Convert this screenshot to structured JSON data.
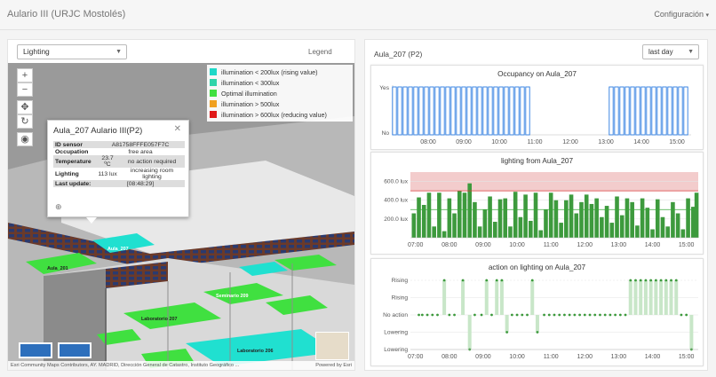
{
  "header": {
    "title": "Aulario III (URJC Mostolés)",
    "config_label": "Configuración",
    "config_caret": "▾"
  },
  "map_panel": {
    "layer_select": "Lighting",
    "legend_title": "Legend",
    "legend": [
      {
        "label": "illumination < 200lux (rising value)",
        "color": "#1ed8c8"
      },
      {
        "label": "illumination < 300lux",
        "color": "#2fd4aa"
      },
      {
        "label": "Optimal illumination",
        "color": "#40e040"
      },
      {
        "label": "illumination > 500lux",
        "color": "#f0a020"
      },
      {
        "label": "illumination > 600lux (reducing value)",
        "color": "#e01818"
      }
    ],
    "zoom_in": "+",
    "zoom_out": "−",
    "pan_icon": "✥",
    "rotate_icon": "↻",
    "eye_icon": "◉",
    "popup": {
      "title": "Aula_207 Aulario III(P2)",
      "close": "✕",
      "rows": [
        {
          "key": "ID sensor",
          "v1": "A81758FFFE057F7C",
          "v2": ""
        },
        {
          "key": "Occupation",
          "v1": "free area",
          "v2": ""
        },
        {
          "key": "Temperature",
          "v1": "23.7 ºC",
          "v2": "no action required"
        },
        {
          "key": "Lighting",
          "v1": "113 lux",
          "v2": "increasing room lighting"
        },
        {
          "key": "Last update:",
          "v1": "[08:48:29]",
          "v2": ""
        }
      ],
      "zoom_icon": "⊕"
    },
    "room_labels": [
      "Aula_201",
      "Aula_207",
      "Seminario 209",
      "Laboratorio 207",
      "Laboratorio 206"
    ],
    "attribution": "Esri Community Maps Contributors, AY. MADRID, Dirección General de Catastro, Instituto Geográfico ...",
    "powered": "Powered by Esri"
  },
  "chart_panel": {
    "room_title": "Aula_207 (P2)",
    "range_select": "last day"
  },
  "chart_data": [
    {
      "type": "bar",
      "title": "Occupancy on Aula_207",
      "y_categories": [
        "No",
        "Yes"
      ],
      "x_ticks": [
        "08:00",
        "09:00",
        "10:00",
        "11:00",
        "12:00",
        "13:00",
        "14:00",
        "15:00"
      ],
      "x_range": [
        7.0,
        15.4
      ],
      "values": [
        {
          "t": 7.05,
          "v": 1
        },
        {
          "t": 7.2,
          "v": 1
        },
        {
          "t": 7.35,
          "v": 1
        },
        {
          "t": 7.5,
          "v": 1
        },
        {
          "t": 7.65,
          "v": 1
        },
        {
          "t": 7.8,
          "v": 1
        },
        {
          "t": 7.95,
          "v": 1
        },
        {
          "t": 8.1,
          "v": 1
        },
        {
          "t": 8.25,
          "v": 1
        },
        {
          "t": 8.4,
          "v": 1
        },
        {
          "t": 8.55,
          "v": 1
        },
        {
          "t": 8.7,
          "v": 1
        },
        {
          "t": 8.85,
          "v": 1
        },
        {
          "t": 9.0,
          "v": 1
        },
        {
          "t": 9.15,
          "v": 1
        },
        {
          "t": 9.3,
          "v": 1
        },
        {
          "t": 9.45,
          "v": 1
        },
        {
          "t": 9.6,
          "v": 1
        },
        {
          "t": 9.75,
          "v": 1
        },
        {
          "t": 9.9,
          "v": 1
        },
        {
          "t": 10.05,
          "v": 1
        },
        {
          "t": 10.2,
          "v": 1
        },
        {
          "t": 10.35,
          "v": 1
        },
        {
          "t": 10.5,
          "v": 1
        },
        {
          "t": 10.65,
          "v": 1
        },
        {
          "t": 10.8,
          "v": 1
        },
        {
          "t": 13.15,
          "v": 1
        },
        {
          "t": 13.3,
          "v": 1
        },
        {
          "t": 13.45,
          "v": 1
        },
        {
          "t": 13.6,
          "v": 1
        },
        {
          "t": 13.75,
          "v": 1
        },
        {
          "t": 13.9,
          "v": 1
        },
        {
          "t": 14.05,
          "v": 1
        },
        {
          "t": 14.2,
          "v": 1
        },
        {
          "t": 14.35,
          "v": 1
        },
        {
          "t": 14.5,
          "v": 1
        },
        {
          "t": 14.65,
          "v": 1
        },
        {
          "t": 14.8,
          "v": 1
        },
        {
          "t": 14.95,
          "v": 1
        },
        {
          "t": 15.1,
          "v": 1
        },
        {
          "t": 15.25,
          "v": 1
        }
      ],
      "color": "#2b7be0"
    },
    {
      "type": "bar",
      "title": "lighting from Aula_207",
      "ylabel_unit": "lux",
      "y_ticks": [
        "200.0 lux",
        "400.0 lux",
        "600.0 lux"
      ],
      "y_range": [
        0,
        700
      ],
      "x_ticks": [
        "07:00",
        "08:00",
        "09:00",
        "10:00",
        "11:00",
        "12:00",
        "13:00",
        "14:00",
        "15:00"
      ],
      "x_range": [
        6.85,
        15.35
      ],
      "threshold_high": 500,
      "threshold_low": 300,
      "band_high": [
        500,
        700
      ],
      "color": "#3d9a3d",
      "values": [
        {
          "t": 6.95,
          "v": 260
        },
        {
          "t": 7.1,
          "v": 430
        },
        {
          "t": 7.25,
          "v": 350
        },
        {
          "t": 7.4,
          "v": 480
        },
        {
          "t": 7.55,
          "v": 120
        },
        {
          "t": 7.7,
          "v": 480
        },
        {
          "t": 7.85,
          "v": 70
        },
        {
          "t": 8.0,
          "v": 420
        },
        {
          "t": 8.15,
          "v": 260
        },
        {
          "t": 8.3,
          "v": 500
        },
        {
          "t": 8.45,
          "v": 480
        },
        {
          "t": 8.6,
          "v": 580
        },
        {
          "t": 8.75,
          "v": 380
        },
        {
          "t": 8.9,
          "v": 120
        },
        {
          "t": 9.05,
          "v": 300
        },
        {
          "t": 9.2,
          "v": 440
        },
        {
          "t": 9.35,
          "v": 170
        },
        {
          "t": 9.5,
          "v": 410
        },
        {
          "t": 9.65,
          "v": 420
        },
        {
          "t": 9.8,
          "v": 120
        },
        {
          "t": 9.95,
          "v": 490
        },
        {
          "t": 10.1,
          "v": 220
        },
        {
          "t": 10.25,
          "v": 460
        },
        {
          "t": 10.4,
          "v": 180
        },
        {
          "t": 10.55,
          "v": 480
        },
        {
          "t": 10.7,
          "v": 80
        },
        {
          "t": 10.85,
          "v": 300
        },
        {
          "t": 11.0,
          "v": 480
        },
        {
          "t": 11.15,
          "v": 400
        },
        {
          "t": 11.3,
          "v": 160
        },
        {
          "t": 11.45,
          "v": 400
        },
        {
          "t": 11.6,
          "v": 460
        },
        {
          "t": 11.75,
          "v": 260
        },
        {
          "t": 11.9,
          "v": 380
        },
        {
          "t": 12.05,
          "v": 460
        },
        {
          "t": 12.2,
          "v": 360
        },
        {
          "t": 12.35,
          "v": 420
        },
        {
          "t": 12.5,
          "v": 220
        },
        {
          "t": 12.65,
          "v": 340
        },
        {
          "t": 12.8,
          "v": 160
        },
        {
          "t": 12.95,
          "v": 440
        },
        {
          "t": 13.1,
          "v": 240
        },
        {
          "t": 13.25,
          "v": 420
        },
        {
          "t": 13.4,
          "v": 380
        },
        {
          "t": 13.55,
          "v": 130
        },
        {
          "t": 13.7,
          "v": 420
        },
        {
          "t": 13.85,
          "v": 320
        },
        {
          "t": 14.0,
          "v": 90
        },
        {
          "t": 14.15,
          "v": 410
        },
        {
          "t": 14.3,
          "v": 220
        },
        {
          "t": 14.45,
          "v": 120
        },
        {
          "t": 14.6,
          "v": 380
        },
        {
          "t": 14.75,
          "v": 260
        },
        {
          "t": 14.9,
          "v": 90
        },
        {
          "t": 15.05,
          "v": 420
        },
        {
          "t": 15.2,
          "v": 330
        },
        {
          "t": 15.3,
          "v": 480
        }
      ]
    },
    {
      "type": "scatter",
      "title": "action on lighting on Aula_207",
      "y_categories": [
        "Lowering",
        "Lowering",
        "No action",
        "Rising",
        "Rising"
      ],
      "x_ticks": [
        "07:00",
        "08:00",
        "09:00",
        "10:00",
        "11:00",
        "12:00",
        "13:00",
        "14:00",
        "15:00"
      ],
      "x_range": [
        6.85,
        15.35
      ],
      "color": "#c8e6c8",
      "values": [
        {
          "t": 7.1,
          "v": 0
        },
        {
          "t": 7.2,
          "v": 0
        },
        {
          "t": 7.35,
          "v": 0
        },
        {
          "t": 7.5,
          "v": 0
        },
        {
          "t": 7.65,
          "v": 0
        },
        {
          "t": 7.85,
          "v": 2
        },
        {
          "t": 8.0,
          "v": 0
        },
        {
          "t": 8.15,
          "v": 0
        },
        {
          "t": 8.4,
          "v": 2
        },
        {
          "t": 8.6,
          "v": -2
        },
        {
          "t": 8.75,
          "v": 0
        },
        {
          "t": 8.95,
          "v": 0
        },
        {
          "t": 9.1,
          "v": 2
        },
        {
          "t": 9.25,
          "v": 0
        },
        {
          "t": 9.4,
          "v": 2
        },
        {
          "t": 9.55,
          "v": 2
        },
        {
          "t": 9.7,
          "v": -1
        },
        {
          "t": 9.85,
          "v": 0
        },
        {
          "t": 10.0,
          "v": 0
        },
        {
          "t": 10.15,
          "v": 0
        },
        {
          "t": 10.3,
          "v": 0
        },
        {
          "t": 10.45,
          "v": 2
        },
        {
          "t": 10.6,
          "v": -1
        },
        {
          "t": 10.8,
          "v": 0
        },
        {
          "t": 10.95,
          "v": 0
        },
        {
          "t": 11.1,
          "v": 0
        },
        {
          "t": 11.25,
          "v": 0
        },
        {
          "t": 11.4,
          "v": 0
        },
        {
          "t": 11.55,
          "v": 0
        },
        {
          "t": 11.7,
          "v": 0
        },
        {
          "t": 11.85,
          "v": 0
        },
        {
          "t": 12.0,
          "v": 0
        },
        {
          "t": 12.15,
          "v": 0
        },
        {
          "t": 12.3,
          "v": 0
        },
        {
          "t": 12.45,
          "v": 0
        },
        {
          "t": 12.6,
          "v": 0
        },
        {
          "t": 12.75,
          "v": 0
        },
        {
          "t": 12.9,
          "v": 0
        },
        {
          "t": 13.05,
          "v": 0
        },
        {
          "t": 13.2,
          "v": 0
        },
        {
          "t": 13.35,
          "v": 2
        },
        {
          "t": 13.5,
          "v": 2
        },
        {
          "t": 13.65,
          "v": 2
        },
        {
          "t": 13.8,
          "v": 2
        },
        {
          "t": 13.95,
          "v": 2
        },
        {
          "t": 14.1,
          "v": 2
        },
        {
          "t": 14.25,
          "v": 2
        },
        {
          "t": 14.4,
          "v": 2
        },
        {
          "t": 14.55,
          "v": 2
        },
        {
          "t": 14.7,
          "v": 2
        },
        {
          "t": 14.85,
          "v": 0
        },
        {
          "t": 15.0,
          "v": 0
        },
        {
          "t": 15.15,
          "v": -2
        }
      ]
    }
  ]
}
